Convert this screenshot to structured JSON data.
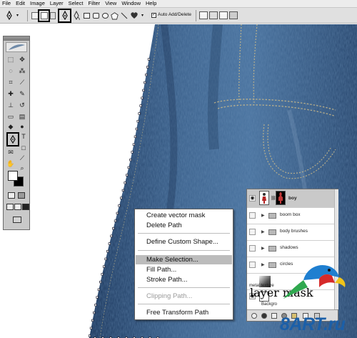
{
  "menubar": {
    "items": [
      "File",
      "Edit",
      "Image",
      "Layer",
      "Select",
      "Filter",
      "View",
      "Window",
      "Help"
    ]
  },
  "options_bar": {
    "auto_add_delete_label": "Auto Add/Delete",
    "auto_add_delete_checked": true
  },
  "context_menu": {
    "items": [
      {
        "label": "Create vector mask",
        "enabled": true
      },
      {
        "label": "Delete Path",
        "enabled": true
      },
      {
        "label": "Define Custom Shape...",
        "enabled": true
      },
      {
        "label": "Make Selection...",
        "enabled": true,
        "highlighted": true
      },
      {
        "label": "Fill Path...",
        "enabled": true
      },
      {
        "label": "Stroke Path...",
        "enabled": true
      },
      {
        "label": "Clipping Path...",
        "enabled": false
      },
      {
        "label": "Free Transform Path",
        "enabled": true
      }
    ]
  },
  "layers_panel": {
    "layers": [
      {
        "name": "boy",
        "type": "layer-with-mask",
        "selected": true
      },
      {
        "name": "boom box",
        "type": "group"
      },
      {
        "name": "body brushes",
        "type": "group"
      },
      {
        "name": "shadows",
        "type": "group"
      },
      {
        "name": "circles",
        "type": "group"
      },
      {
        "name": "metal texture",
        "type": "layer"
      },
      {
        "name": "Backgro",
        "type": "layer"
      }
    ]
  },
  "caption": "layer mask",
  "watermark": "8ART.ru",
  "colors": {
    "menu_highlight": "#bcbcbc",
    "denim_base": "#2f4f79",
    "watermark_blue": "#1b5fa8",
    "foreground_swatch": "#ffffff",
    "background_swatch": "#000000"
  }
}
